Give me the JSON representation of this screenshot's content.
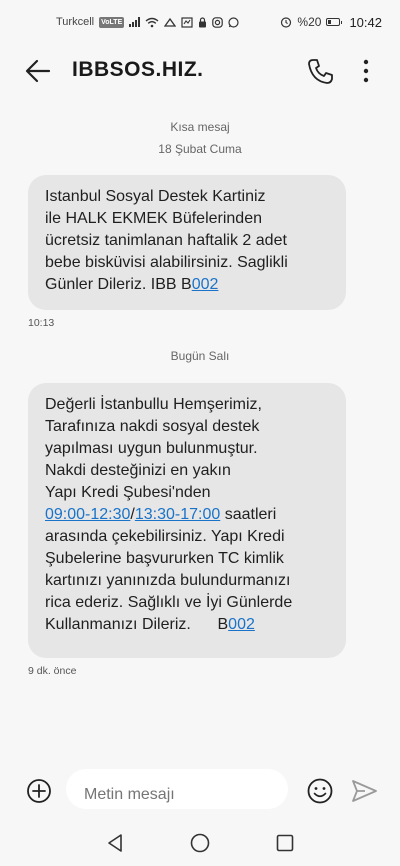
{
  "status_bar": {
    "carrier": "Turkcell",
    "network_badge": "VoLTE",
    "battery": "%20",
    "time": "10:42"
  },
  "header": {
    "title": "IBBSOS.HIZ.",
    "icons": [
      "back-arrow-icon",
      "phone-icon",
      "more-vert-icon"
    ]
  },
  "thread": {
    "label": "Kısa mesaj",
    "messages": [
      {
        "date": "18 Şubat Cuma",
        "lines": [
          "Istanbul Sosyal Destek Kartiniz",
          "ile HALK EKMEK Büfelerinden",
          "ücretsiz tanimlanan haftalik 2 adet",
          "bebe bisküvisi alabilirsiniz. Saglikli",
          "Günler Dileriz. IBB B"
        ],
        "link": "002",
        "time": "10:13"
      },
      {
        "date": "Bugün Salı",
        "lines": [
          "Değerli İstanbullu Hemşerimiz,",
          "Tarafınıza nakdi sosyal destek",
          "yapılması uygun bulunmuştur.",
          "Nakdi desteğinizi en yakın",
          "Yapı Kredi Şubesi'nden"
        ],
        "hours_link_1": "09:00-12:30",
        "hours_sep": "/",
        "hours_link_2": "13:30-17:00",
        "hours_suffix": " saatleri",
        "lines_after": [
          "arasında çekebilirsiniz. Yapı Kredi",
          "Şubelerine başvururken TC kimlik",
          "kartınızı yanınızda bulundurmanızı",
          "rica ederiz. Sağlıklı ve İyi Günlerde"
        ],
        "last_line": "Kullanmanızı Dileriz.      B",
        "link": "002",
        "time": "9 dk. önce"
      }
    ]
  },
  "composer": {
    "placeholder": "Metin mesajı"
  },
  "colors": {
    "background": "#f7f7f7",
    "bubble": "#e6e6e6",
    "link": "#1a73c8"
  }
}
